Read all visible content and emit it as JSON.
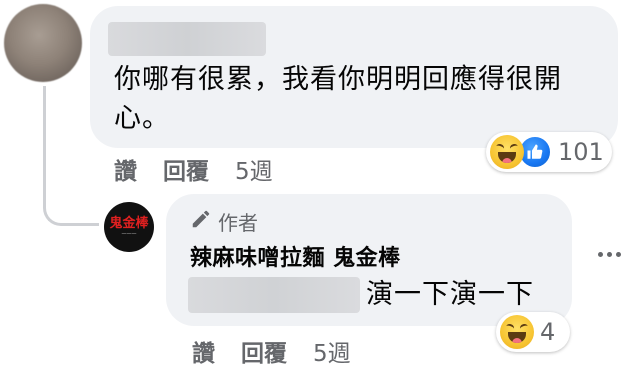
{
  "comment": {
    "text": "你哪有很累，我看你明明回應得很開心。",
    "reactions": {
      "types": [
        "haha",
        "like"
      ],
      "count": "101"
    },
    "actions": {
      "like": "讚",
      "reply": "回覆",
      "time": "5週"
    }
  },
  "reply": {
    "author_badge": "作者",
    "page_name": "辣麻味噌拉麵 鬼金棒",
    "avatar_logo_text": "鬼金棒",
    "text": "演一下演一下",
    "reactions": {
      "types": [
        "haha"
      ],
      "count": "4"
    },
    "actions": {
      "like": "讚",
      "reply": "回覆",
      "time": "5週"
    }
  },
  "icons": {
    "author": "pencil-icon",
    "more": "more-options-icon"
  }
}
